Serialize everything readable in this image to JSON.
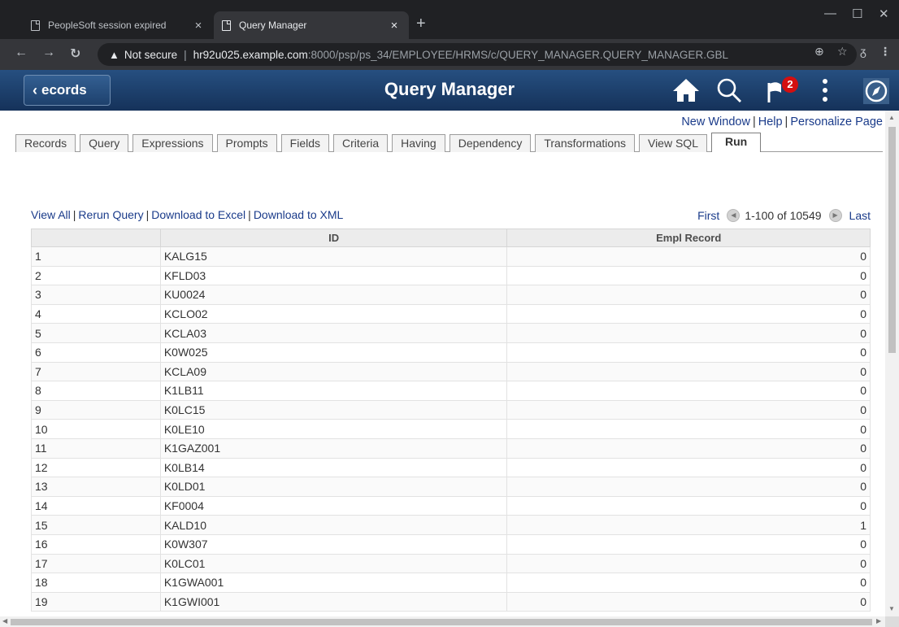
{
  "browser": {
    "tabs": [
      {
        "title": "PeopleSoft session expired",
        "active": false
      },
      {
        "title": "Query Manager",
        "active": true
      }
    ],
    "new_tab": "+",
    "window_controls": {
      "minimize": "—",
      "maximize": "☐",
      "close": "✕"
    },
    "address": {
      "warning": "Not secure",
      "host": "hr92u025.example.com",
      "path": ":8000/psp/ps_34/EMPLOYEE/HRMS/c/QUERY_MANAGER.QUERY_MANAGER.GBL"
    }
  },
  "banner": {
    "back_label": "ecords",
    "title": "Query Manager",
    "notification_count": "2"
  },
  "page_links": [
    "New Window",
    "Help",
    "Personalize Page"
  ],
  "query_tabs": [
    "Records",
    "Query",
    "Expressions",
    "Prompts",
    "Fields",
    "Criteria",
    "Having",
    "Dependency",
    "Transformations",
    "View SQL",
    "Run"
  ],
  "active_tab": "Run",
  "result_links": [
    "View All",
    "Rerun Query",
    "Download to Excel",
    "Download to XML"
  ],
  "pager": {
    "first": "First",
    "range": "1-100 of 10549",
    "last": "Last"
  },
  "grid": {
    "columns": [
      "",
      "ID",
      "Empl Record"
    ],
    "rows": [
      [
        "1",
        "KALG15",
        "0"
      ],
      [
        "2",
        "KFLD03",
        "0"
      ],
      [
        "3",
        "KU0024",
        "0"
      ],
      [
        "4",
        "KCLO02",
        "0"
      ],
      [
        "5",
        "KCLA03",
        "0"
      ],
      [
        "6",
        "K0W025",
        "0"
      ],
      [
        "7",
        "KCLA09",
        "0"
      ],
      [
        "8",
        "K1LB11",
        "0"
      ],
      [
        "9",
        "K0LC15",
        "0"
      ],
      [
        "10",
        "K0LE10",
        "0"
      ],
      [
        "11",
        "K1GAZ001",
        "0"
      ],
      [
        "12",
        "K0LB14",
        "0"
      ],
      [
        "13",
        "K0LD01",
        "0"
      ],
      [
        "14",
        "KF0004",
        "0"
      ],
      [
        "15",
        "KALD10",
        "1"
      ],
      [
        "16",
        "K0W307",
        "0"
      ],
      [
        "17",
        "K0LC01",
        "0"
      ],
      [
        "18",
        "K1GWA001",
        "0"
      ],
      [
        "19",
        "K1GWI001",
        "0"
      ]
    ]
  }
}
